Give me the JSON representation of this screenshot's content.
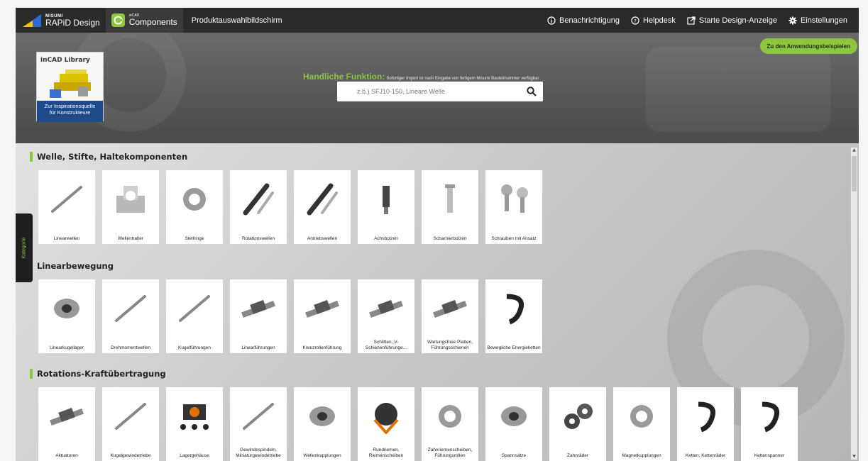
{
  "topbar": {
    "brand_small": "MISUMI",
    "brand_main": "RAPiD Design",
    "components_small": "inCAD",
    "components_main": "Components",
    "screen_title": "Produktauswahlbildschirm",
    "nav": [
      {
        "label": "Benachrichtigung",
        "icon": "info-icon"
      },
      {
        "label": "Helpdesk",
        "icon": "help-icon"
      },
      {
        "label": "Starte Design-Anzeige",
        "icon": "external-link-icon"
      },
      {
        "label": "Einstellungen",
        "icon": "gear-icon"
      }
    ]
  },
  "hero": {
    "library_label": "inCAD Library",
    "library_caption_1": "Zur Inspirationsquelle",
    "library_caption_2": "für Konstrukteure",
    "tagline_highlight": "Handliche Funktion:",
    "tagline_small": "Sofortiger Import ist nach Eingabe von fertigem Misumi Bauteilnummer verfügbar",
    "search_placeholder": "z.b.) SFJ10-150, Lineare Welle",
    "examples_button": "Zu den Anwendungsbeispielen"
  },
  "sidebar_tab": "Kategorie",
  "accent_color": "#8cc63f",
  "sections": [
    {
      "title": "Welle, Stifte, Haltekomponenten",
      "items": [
        "Linearwellen",
        "Wellenhalter",
        "Stellringe",
        "Rotationswellen",
        "Antriebswellen",
        "Achsbolzen",
        "Scharnierbolzen",
        "Schrauben mit Ansatz"
      ]
    },
    {
      "title": "Linearbewegung",
      "items": [
        "Linearkugellager",
        "Drehmomentwellen",
        "Kugelführungen",
        "Linearführungen",
        "Kreuzrollenführung",
        "Schlitten, V-Schienenführunge...",
        "Wartungsfreie Platten, Führungsschienen",
        "Bewegliche Energieketten"
      ]
    },
    {
      "title": "Rotations-Kraftübertragung",
      "items": [
        "Aktuatoren",
        "Kugelgewindetriebe",
        "Lagergehäuse",
        "Gewindespindeln, Miniaturgewindetriebe",
        "Wellenkupplungen",
        "Rundriemen, Riemenscheiben",
        "Zahnriemenscheiben, Führungsrollen",
        "Spannsätze",
        "Zahnräder",
        "Magnetkupplungen",
        "Ketten, Kettenräder",
        "Kettenspanner"
      ]
    }
  ]
}
